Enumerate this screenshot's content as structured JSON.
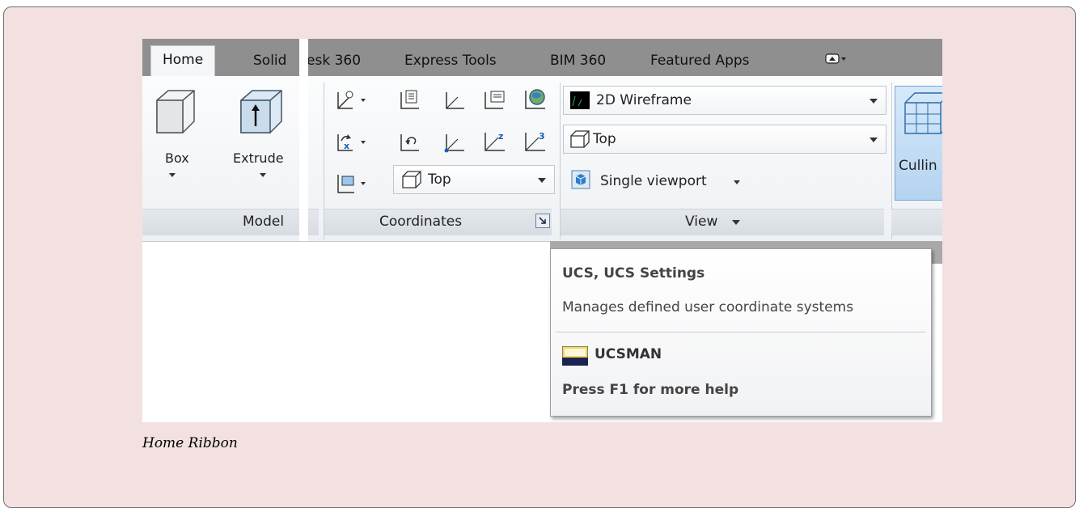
{
  "tabs": [
    "Home",
    "Solid",
    "esk 360",
    "Express Tools",
    "BIM 360",
    "Featured Apps"
  ],
  "tab_menu_icon": "minimize-ribbon-icon",
  "model_panel": {
    "title": "Model",
    "box_label": "Box",
    "extrude_label": "Extrude"
  },
  "coordinates_panel": {
    "title": "Coordinates",
    "view_combo_value": "Top"
  },
  "view_panel": {
    "title": "View",
    "visual_style_value": "2D Wireframe",
    "view_value": "Top",
    "viewport_label": "Single viewport"
  },
  "culling_label": "Cullin",
  "tooltip": {
    "title": "UCS, UCS Settings",
    "description": "Manages defined user coordinate systems",
    "command": "UCSMAN",
    "help": "Press F1 for more help"
  },
  "caption": "Home Ribbon",
  "colors": {
    "frame_background": "#f3e1e1",
    "tab_strip": "#8f8f8f",
    "culling_highlight": "#bcd9f5"
  }
}
